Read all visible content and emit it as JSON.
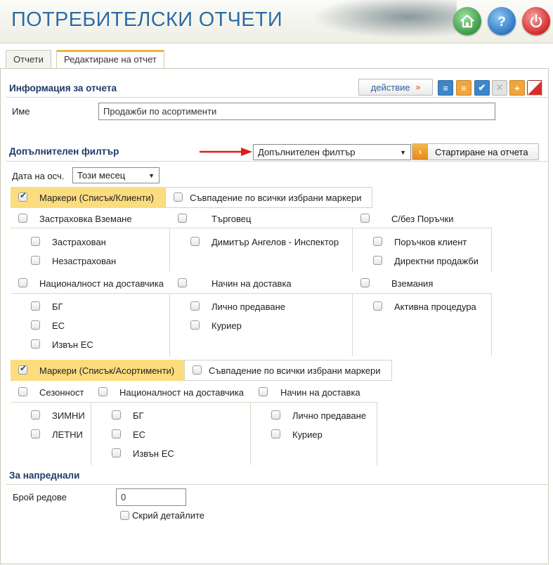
{
  "app": {
    "title": "ПОТРЕБИТЕЛСКИ ОТЧЕТИ"
  },
  "header_buttons": {
    "home": "home-icon",
    "help": "help-icon",
    "power": "power-icon"
  },
  "tabs": [
    {
      "label": "Отчети"
    },
    {
      "label": "Редактиране на отчет"
    }
  ],
  "report_info": {
    "title": "Информация за отчета",
    "action_label": "действие",
    "action_glyph": "»",
    "name_label": "Име",
    "name_value": "Продажби по асортименти"
  },
  "extra_filter": {
    "title": "Допълнителен филтър",
    "select_value": "Допълнителен филтър",
    "run_label": "Стартиране на отчета",
    "date_label": "Дата на осч.",
    "date_value": "Този месец"
  },
  "markers_clients": {
    "label": "Маркери (Списък/Клиенти)",
    "match_all": "Съвпадение по всички избрани маркери",
    "groups_row1": [
      {
        "label": "Застраховка Вземане",
        "items": [
          "Застрахован",
          "Незастрахован"
        ]
      },
      {
        "label": "Търговец",
        "items": [
          "Димитър Ангелов - Инспектор"
        ]
      },
      {
        "label": "С/без Поръчки",
        "items": [
          "Поръчков клиент",
          "Директни продажби"
        ]
      }
    ],
    "groups_row2": [
      {
        "label": "Националност на доставчика",
        "items": [
          "БГ",
          "ЕС",
          "Извън ЕС"
        ]
      },
      {
        "label": "Начин на доставка",
        "items": [
          "Лично предаване",
          "Куриер"
        ]
      },
      {
        "label": "Вземания",
        "items": [
          "Активна процедура"
        ]
      }
    ]
  },
  "markers_assortment": {
    "label": "Маркери (Списък/Асортименти)",
    "match_all": "Съвпадение по всички избрани маркери",
    "groups": [
      {
        "label": "Сезонност",
        "items": [
          "ЗИМНИ",
          "ЛЕТНИ"
        ]
      },
      {
        "label": "Националност на доставчика",
        "items": [
          "БГ",
          "ЕС",
          "Извън ЕС"
        ]
      },
      {
        "label": "Начин на доставка",
        "items": [
          "Лично предаване",
          "Куриер"
        ]
      }
    ]
  },
  "advanced": {
    "title": "За напреднали",
    "rows_label": "Брой редове",
    "rows_value": "0",
    "hide_details": "Скрий детайлите"
  }
}
